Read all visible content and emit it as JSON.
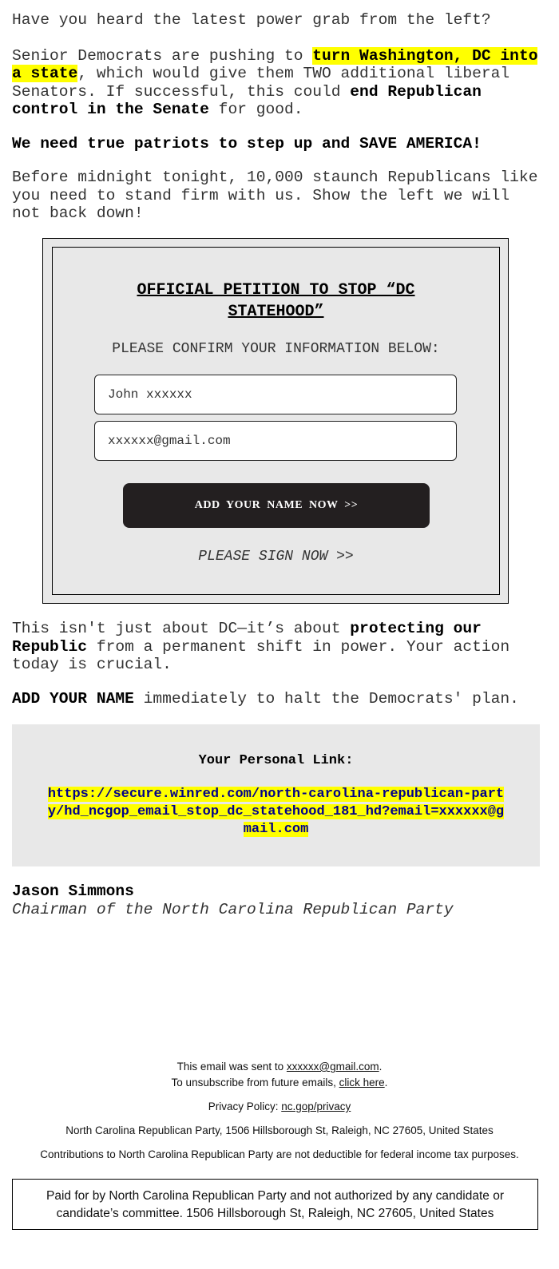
{
  "intro": {
    "p1": "Have you heard the latest power grab from the left?",
    "p2_a": "Senior Democrats are pushing to ",
    "p2_hl": "turn Washington, DC into a state",
    "p2_b": ", which would give them TWO additional liberal Senators. If successful, this could ",
    "p2_bold": "end Republican control in the Senate",
    "p2_c": " for good.",
    "p3": "We need true patriots to step up and SAVE AMERICA!",
    "p4": "Before midnight tonight, 10,000 staunch Republicans like you need to stand firm with us. Show the left we will not back down!"
  },
  "petition": {
    "title": "OFFICIAL PETITION TO STOP “DC STATEHOOD”",
    "confirm": "PLEASE CONFIRM YOUR INFORMATION BELOW:",
    "name_value": "John xxxxxx",
    "email_value": "xxxxxx@gmail.com",
    "button": "ADD YOUR NAME NOW >>",
    "sign_now": "PLEASE SIGN NOW >>"
  },
  "body2": {
    "p5_a": "This isn't just about DC—it’s about ",
    "p5_bold1": "protecting our Republic",
    "p5_b": " from a permanent shift in power. Your action today is crucial.",
    "p6_bold": "ADD YOUR NAME",
    "p6_rest": " immediately to halt the Democrats' plan."
  },
  "link_box": {
    "label": "Your Personal Link:",
    "url": "https://secure.winred.com/north-carolina-republican-party/hd_ncgop_email_stop_dc_statehood_181_hd?email=xxxxxx@gmail.com"
  },
  "signature": {
    "name": "Jason Simmons",
    "title": "Chairman of the North Carolina Republican Party"
  },
  "footer": {
    "sent_prefix": "This email was sent to ",
    "sent_email": "xxxxxx@gmail.com",
    "unsub_prefix": "To unsubscribe from future emails, ",
    "unsub_link": "click here",
    "privacy_prefix": "Privacy Policy: ",
    "privacy_link": "nc.gop/privacy",
    "address": "North Carolina Republican Party, 1506 Hillsborough St, Raleigh, NC 27605, United States",
    "contributions": "Contributions to North Carolina Republican Party are not deductible for federal income tax purposes.",
    "paid_for": "Paid for by North Carolina Republican Party and not authorized by any candidate or candidate’s committee. 1506 Hillsborough St, Raleigh, NC 27605, United States"
  },
  "colors": {
    "highlight": "#ffff00",
    "link": "#00008b",
    "button_bg": "#231f20",
    "panel_bg": "#e8e8e8"
  }
}
